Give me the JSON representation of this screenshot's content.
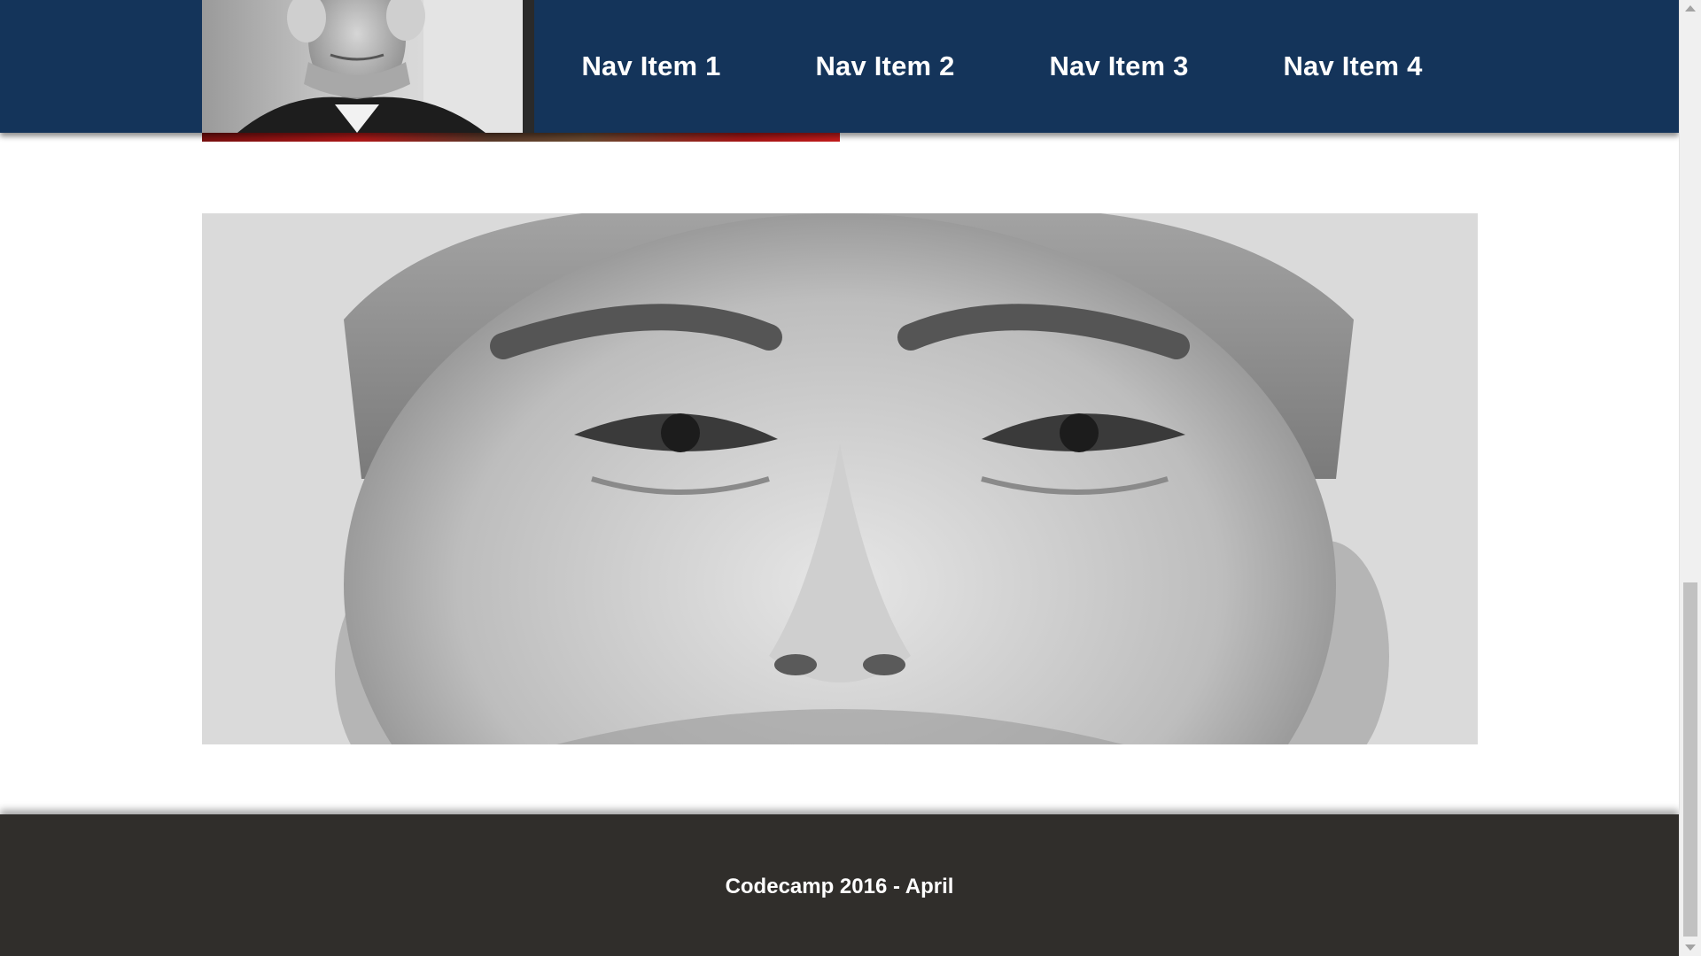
{
  "header": {
    "nav_items": [
      {
        "label": "Nav Item 1"
      },
      {
        "label": "Nav Item 2"
      },
      {
        "label": "Nav Item 3"
      },
      {
        "label": "Nav Item 4"
      }
    ]
  },
  "footer": {
    "text": "Codecamp 2016 - April"
  },
  "colors": {
    "nav_background": "#14345a",
    "footer_background": "#302e2b",
    "accent_red": "#b01818",
    "text": "#ffffff"
  },
  "icons": {
    "scroll_up": "scroll-up-arrow-icon",
    "scroll_down": "scroll-down-arrow-icon"
  }
}
